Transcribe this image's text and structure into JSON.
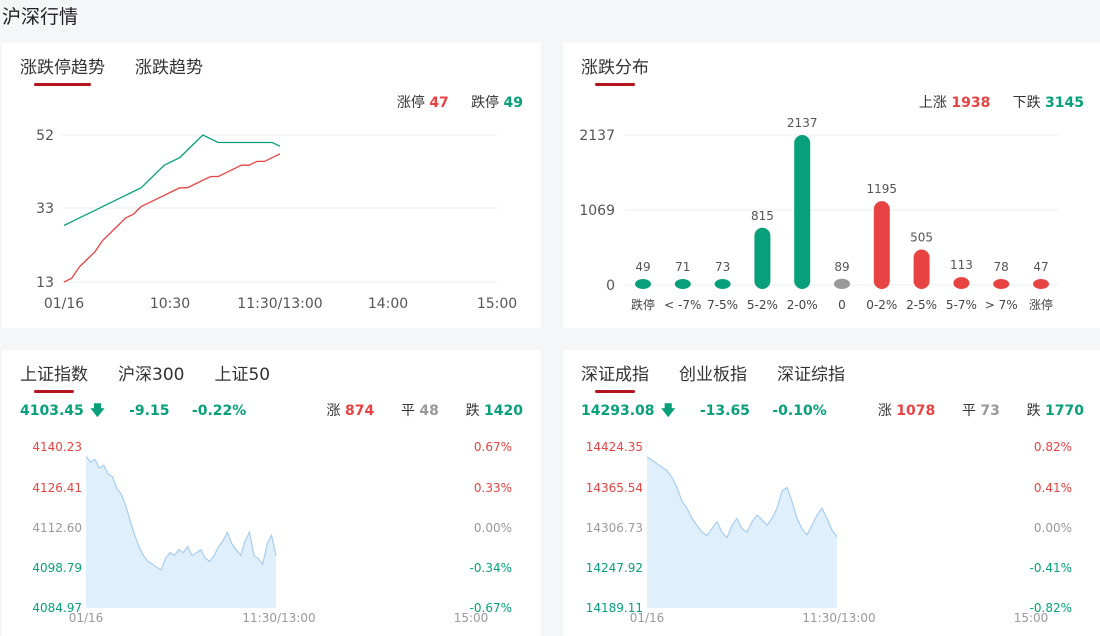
{
  "page": {
    "title": "沪深行情"
  },
  "trend_panel": {
    "tabs": [
      "涨跌停趋势",
      "涨跌趋势"
    ],
    "limit_up_label": "涨停",
    "limit_up_value": "47",
    "limit_down_label": "跌停",
    "limit_down_value": "49",
    "y_ticks": [
      "52",
      "33",
      "13"
    ],
    "x_ticks": [
      "01/16",
      "10:30",
      "11:30/13:00",
      "14:00",
      "15:00"
    ]
  },
  "dist_panel": {
    "tabs": [
      "涨跌分布"
    ],
    "up_label": "上涨",
    "up_value": "1938",
    "down_label": "下跌",
    "down_value": "3145",
    "y_ticks": [
      "2137",
      "1069",
      "0"
    ]
  },
  "sh_panel": {
    "tabs": [
      "上证指数",
      "沪深300",
      "上证50"
    ],
    "price": "4103.45",
    "change": "-9.15",
    "pct": "-0.22%",
    "up_label": "涨",
    "up_value": "874",
    "flat_label": "平",
    "flat_value": "48",
    "down_label": "跌",
    "down_value": "1420",
    "left_ticks": [
      "4140.23",
      "4126.41",
      "4112.60",
      "4098.79",
      "4084.97"
    ],
    "right_ticks": [
      "0.67%",
      "0.33%",
      "0.00%",
      "-0.34%",
      "-0.67%"
    ],
    "x_ticks": [
      "01/16",
      "11:30/13:00",
      "15:00"
    ]
  },
  "sz_panel": {
    "tabs": [
      "深证成指",
      "创业板指",
      "深证综指"
    ],
    "price": "14293.08",
    "change": "-13.65",
    "pct": "-0.10%",
    "up_label": "涨",
    "up_value": "1078",
    "flat_label": "平",
    "flat_value": "73",
    "down_label": "跌",
    "down_value": "1770",
    "left_ticks": [
      "14424.35",
      "14365.54",
      "14306.73",
      "14247.92",
      "14189.11"
    ],
    "right_ticks": [
      "0.82%",
      "0.41%",
      "0.00%",
      "-0.41%",
      "-0.82%"
    ],
    "x_ticks": [
      "01/16",
      "11:30/13:00",
      "15:00"
    ]
  },
  "colors": {
    "up": "#e84343",
    "down": "#07a07b",
    "flat": "#999999",
    "accent": "#b4141d",
    "area": "#d6e9fb",
    "area_line": "#a8cdf2"
  },
  "chart_data": [
    {
      "type": "line",
      "series": [
        {
          "name": "涨停",
          "values": [
            13,
            14,
            17,
            19,
            21,
            24,
            26,
            28,
            30,
            31,
            33,
            34,
            35,
            36,
            37,
            38,
            38,
            39,
            40,
            41,
            41,
            42,
            43,
            44,
            44,
            45,
            45,
            46,
            47
          ]
        },
        {
          "name": "跌停",
          "values": [
            28,
            29,
            30,
            31,
            32,
            33,
            34,
            35,
            36,
            37,
            38,
            40,
            42,
            44,
            45,
            46,
            48,
            50,
            52,
            51,
            50,
            50,
            50,
            50,
            50,
            50,
            50,
            50,
            49
          ]
        }
      ],
      "y_range": [
        13,
        52
      ]
    },
    {
      "type": "bar",
      "categories": [
        "跌停",
        "< -7%",
        "7-5%",
        "5-2%",
        "2-0%",
        "0",
        "0-2%",
        "2-5%",
        "5-7%",
        "> 7%",
        "涨停"
      ],
      "values": [
        49,
        71,
        73,
        815,
        2137,
        89,
        1195,
        505,
        113,
        78,
        47
      ],
      "ylim": [
        0,
        2137
      ]
    },
    {
      "type": "area",
      "name_hidden": true,
      "values": [
        4137,
        4135,
        4136,
        4133,
        4134,
        4131,
        4130,
        4126,
        4124,
        4120,
        4115,
        4110,
        4106,
        4103,
        4101,
        4100,
        4099,
        4098,
        4102,
        4104,
        4103,
        4105,
        4104,
        4106,
        4103,
        4104,
        4105,
        4102,
        4101,
        4103,
        4106,
        4108,
        4111,
        4107,
        4105,
        4103,
        4108,
        4111,
        4103,
        4102,
        4100,
        4107,
        4110,
        4103
      ],
      "ylim": [
        4084.97,
        4140.23
      ]
    },
    {
      "type": "area",
      "values": [
        14410,
        14405,
        14400,
        14395,
        14390,
        14380,
        14365,
        14345,
        14335,
        14320,
        14310,
        14300,
        14295,
        14305,
        14315,
        14300,
        14292,
        14310,
        14320,
        14305,
        14300,
        14315,
        14325,
        14318,
        14310,
        14320,
        14335,
        14360,
        14365,
        14345,
        14320,
        14305,
        14296,
        14310,
        14325,
        14335,
        14320,
        14303,
        14293
      ],
      "ylim": [
        14189.11,
        14424.35
      ]
    }
  ]
}
